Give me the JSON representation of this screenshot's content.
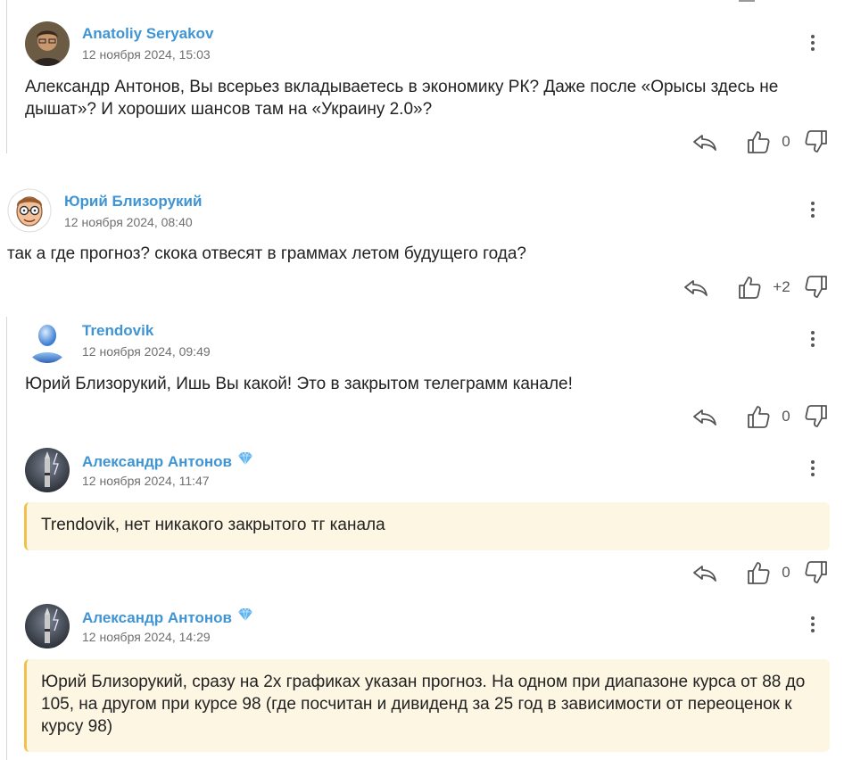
{
  "comments": [
    {
      "author": "Anatoliy Seryakov",
      "date": "12 ноября 2024, 15:03",
      "text": "Александр Антонов, Вы всерьез вкладываетесь в экономику РК? Даже после «Орысы здесь не дышат»? И хороших шансов там на «Украину 2.0»?",
      "rating": "0",
      "verified": false
    },
    {
      "author": "Юрий Близорукий",
      "date": "12 ноября 2024, 08:40",
      "text": "так а где прогноз? скока отвесят в граммах летом будущего года?",
      "rating": "+2",
      "verified": false
    },
    {
      "author": "Trendovik",
      "date": "12 ноября 2024, 09:49",
      "text": "Юрий Близорукий, Ишь Вы какой! Это в закрытом телеграмм канале!",
      "rating": "0",
      "verified": false
    },
    {
      "author": "Александр Антонов",
      "date": "12 ноября 2024, 11:47",
      "text": "Trendovik, нет никакого закрытого тг канала",
      "rating": "0",
      "verified": true
    },
    {
      "author": "Александр Антонов",
      "date": "12 ноября 2024, 14:29",
      "text": "Юрий Близорукий, сразу на 2х графиках указан прогноз. На одном при диапазоне курса от 88 до 105, на другом при курсе 98 (где посчитан и дивиденд за 25 год в зависимости от переоценок к курсу 98)",
      "rating": "",
      "verified": true
    }
  ],
  "icons": {
    "reply": "reply-arrow-icon",
    "like": "thumbs-up-icon",
    "dislike": "thumbs-down-icon",
    "menu": "kebab-menu-icon",
    "verified": "diamond-badge-icon"
  },
  "colors": {
    "author": "#3f95d4",
    "highlight_bg": "#fdf6e3",
    "highlight_border": "#f0c24b",
    "verified_gem": "#4aa8e8"
  }
}
